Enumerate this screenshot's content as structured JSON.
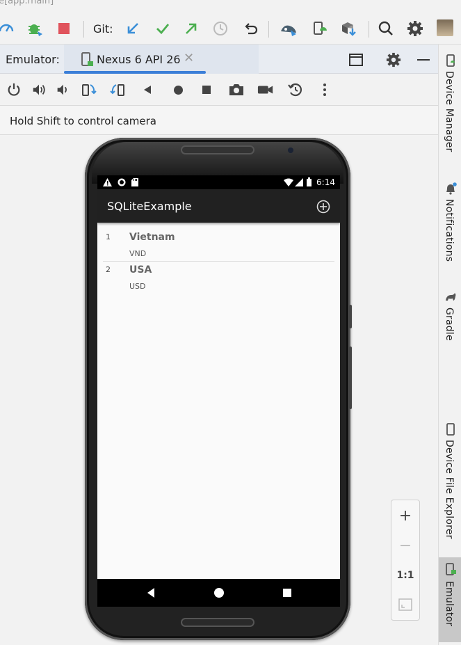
{
  "window": {
    "title_fragment": "e[app.main]"
  },
  "toolbar": {
    "git_label": "Git:",
    "icons": [
      "profiler-icon",
      "debug-icon",
      "stop-icon",
      "git-update-icon",
      "git-commit-icon",
      "git-push-icon",
      "git-history-icon",
      "rollback-icon",
      "android-studio-icon",
      "device-manager-icon",
      "sdk-manager-icon",
      "search-icon",
      "settings-icon",
      "avatar"
    ],
    "colors": {
      "stop": "#e0535c",
      "git_update": "#3b8fd8",
      "git_commit": "#4caf50",
      "git_push": "#4caf50"
    }
  },
  "emulator_tabs": {
    "label": "Emulator:",
    "active_tab": "Nexus 6 API 26",
    "accent": "#3c7fd8"
  },
  "controls": {
    "icons": [
      "power-icon",
      "volume-up-icon",
      "volume-down-icon",
      "rotate-left-icon",
      "rotate-right-icon",
      "back-icon",
      "home-icon",
      "overview-icon",
      "screenshot-icon",
      "screen-record-icon",
      "snapshot-icon",
      "more-icon"
    ]
  },
  "hint": {
    "text": "Hold Shift to control camera"
  },
  "device": {
    "status_time": "6:14",
    "app_title": "SQLiteExample",
    "items": [
      {
        "id": "1",
        "name": "Vietnam",
        "code": "VND"
      },
      {
        "id": "2",
        "name": "USA",
        "code": "USD"
      }
    ]
  },
  "right_bar": {
    "items": [
      {
        "label": "Device Manager"
      },
      {
        "label": "Notifications"
      },
      {
        "label": "Gradle"
      },
      {
        "label": "Device File Explorer"
      },
      {
        "label": "Emulator"
      }
    ]
  },
  "zoom": {
    "plus": "+",
    "minus": "−",
    "one_to_one": "1:1"
  }
}
